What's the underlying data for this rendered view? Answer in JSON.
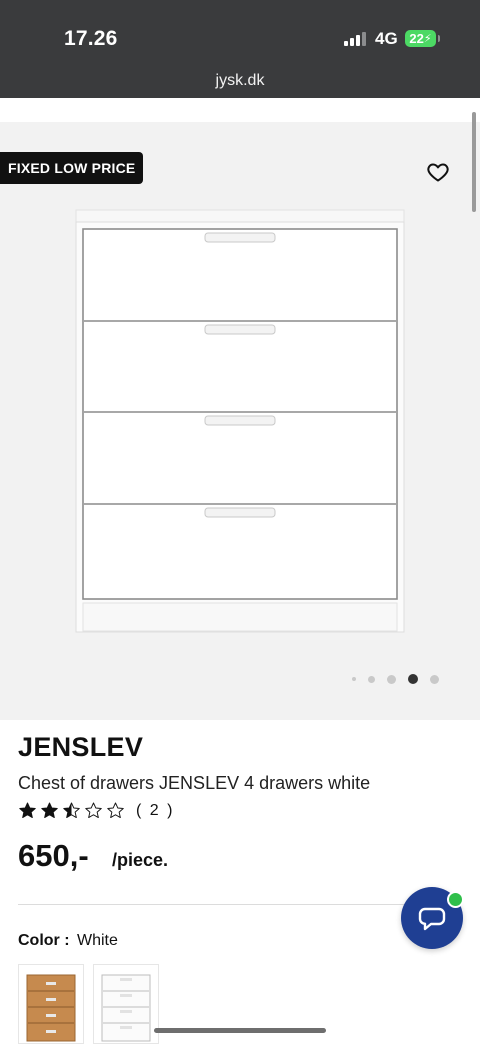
{
  "status_bar": {
    "time": "17.26",
    "network": "4G",
    "battery": "22"
  },
  "browser": {
    "url": "jysk.dk"
  },
  "gallery": {
    "badge": "FIXED LOW PRICE",
    "dots_total": 5,
    "dots_active_index": 3
  },
  "product": {
    "name": "JENSLEV",
    "description": "Chest of drawers JENSLEV 4 drawers white",
    "rating": {
      "value": 2.5,
      "max": 5,
      "count_text": "( 2 )"
    },
    "price": "650,-",
    "unit": "/piece.",
    "color_label": "Color :",
    "color_value": "White"
  },
  "colors": {
    "brand_blue": "#1f3f93",
    "online_green": "#2fbf4a",
    "status_bar": "#3a3b3d"
  },
  "icons": [
    "heart-icon",
    "star-icon",
    "chat-icon"
  ]
}
